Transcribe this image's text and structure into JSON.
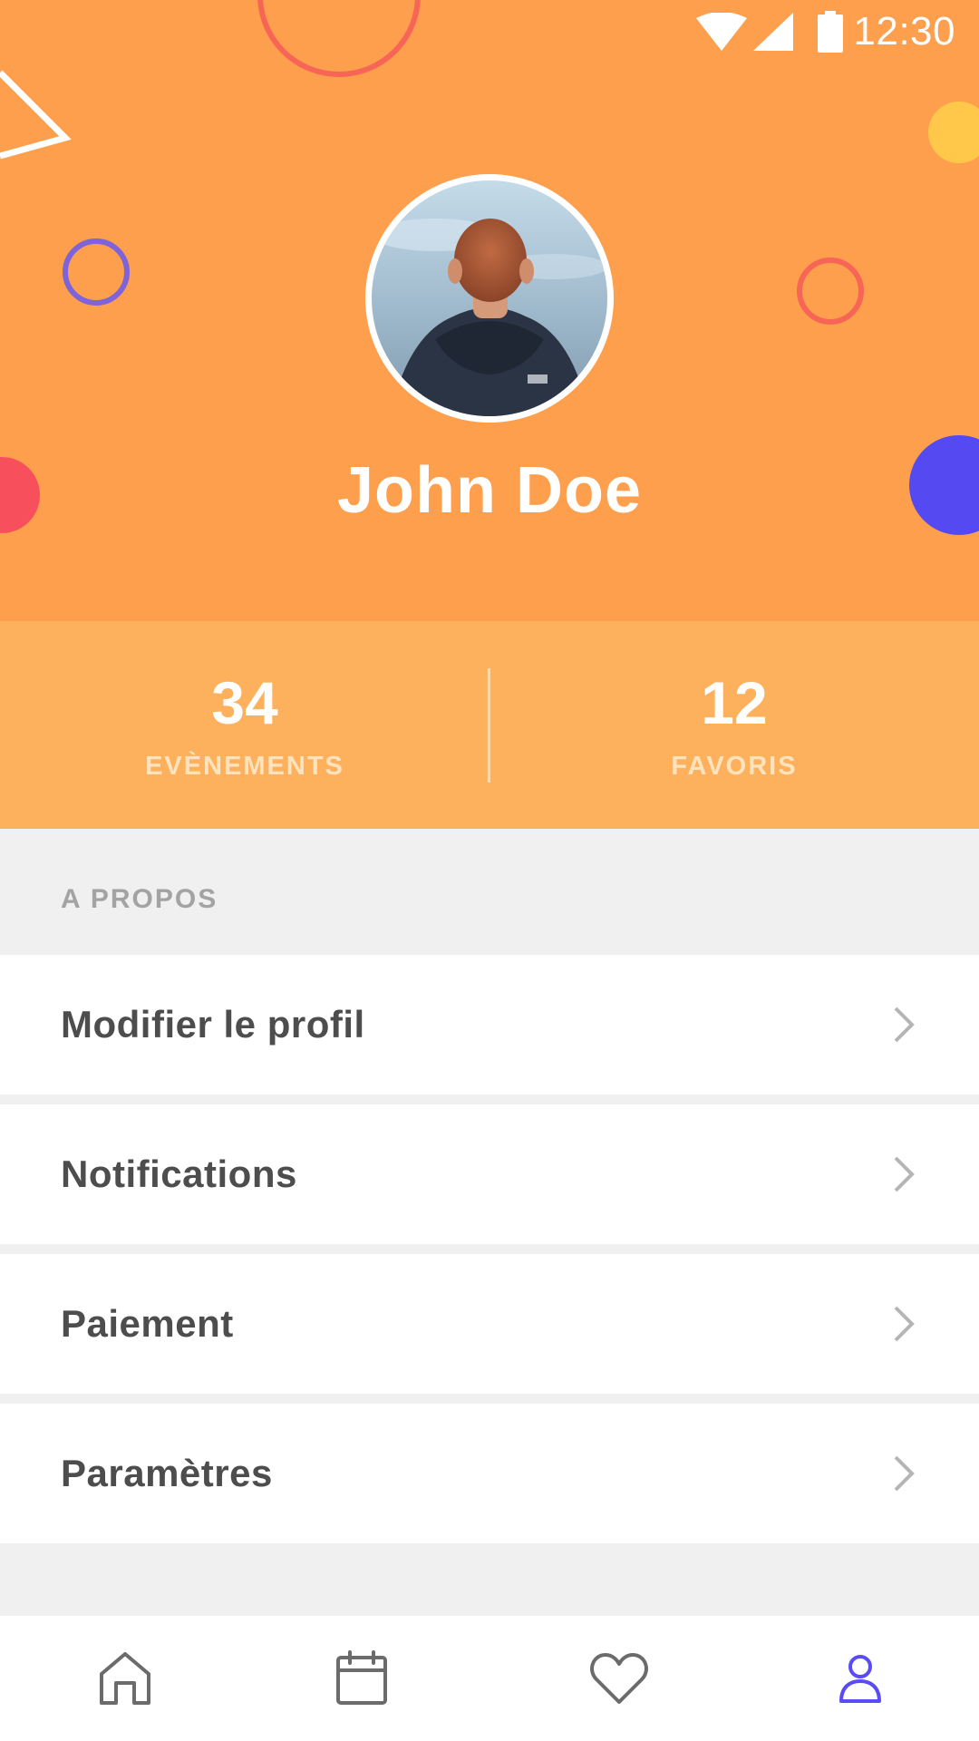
{
  "status_bar": {
    "time": "12:30",
    "icons": [
      "wifi-icon",
      "signal-icon",
      "battery-icon"
    ]
  },
  "profile": {
    "name": "John Doe",
    "avatar": "profile-photo"
  },
  "stats": [
    {
      "value": "34",
      "label": "EVÈNEMENTS"
    },
    {
      "value": "12",
      "label": "FAVORIS"
    }
  ],
  "section": {
    "title": "A PROPOS"
  },
  "menu": {
    "items": [
      {
        "label": "Modifier le profil",
        "icon": "chevron-right-icon"
      },
      {
        "label": "Notifications",
        "icon": "chevron-right-icon"
      },
      {
        "label": "Paiement",
        "icon": "chevron-right-icon"
      },
      {
        "label": "Paramètres",
        "icon": "chevron-right-icon"
      }
    ]
  },
  "bottom_nav": {
    "items": [
      {
        "icon": "home-icon",
        "active": false
      },
      {
        "icon": "calendar-icon",
        "active": false
      },
      {
        "icon": "heart-icon",
        "active": false
      },
      {
        "icon": "user-icon",
        "active": true
      }
    ]
  },
  "colors": {
    "header_bg": "#fe9f4d",
    "stats_bg": "#feb15d",
    "accent": "#5a4cf5",
    "text_dark": "#4d4d4d",
    "text_muted": "#a3a3a3",
    "page_bg": "#f0f0f0"
  }
}
